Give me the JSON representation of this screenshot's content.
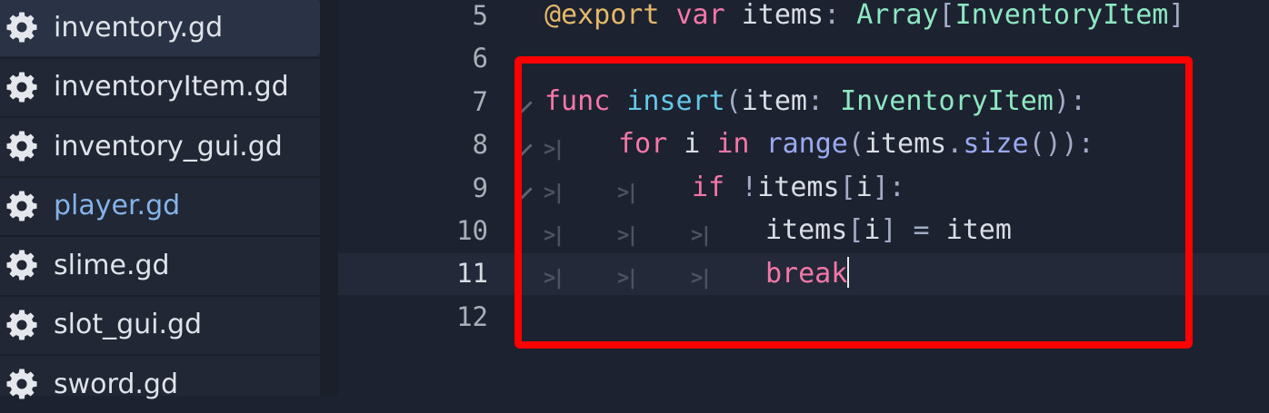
{
  "sidebar": {
    "files": [
      {
        "name": "inventory.gd",
        "selected": true,
        "active": false
      },
      {
        "name": "inventoryItem.gd",
        "selected": false,
        "active": false
      },
      {
        "name": "inventory_gui.gd",
        "selected": false,
        "active": false
      },
      {
        "name": "player.gd",
        "selected": false,
        "active": true
      },
      {
        "name": "slime.gd",
        "selected": false,
        "active": false
      },
      {
        "name": "slot_gui.gd",
        "selected": false,
        "active": false
      },
      {
        "name": "sword.gd",
        "selected": false,
        "active": false
      }
    ]
  },
  "editor": {
    "current_line": 11,
    "lines": [
      {
        "number": "5",
        "indent": 0,
        "tokens": [
          {
            "text": "@export",
            "kind": "annotation"
          },
          {
            "text": " ",
            "kind": "plain"
          },
          {
            "text": "var",
            "kind": "keyword"
          },
          {
            "text": " items",
            "kind": "plain"
          },
          {
            "text": ": ",
            "kind": "punct"
          },
          {
            "text": "Array",
            "kind": "type"
          },
          {
            "text": "[",
            "kind": "punct"
          },
          {
            "text": "InventoryItem",
            "kind": "type"
          },
          {
            "text": "]",
            "kind": "punct"
          }
        ]
      },
      {
        "number": "6",
        "indent": 0,
        "tokens": []
      },
      {
        "number": "7",
        "indent": 0,
        "fold": true,
        "tokens": [
          {
            "text": "func",
            "kind": "keyword"
          },
          {
            "text": " ",
            "kind": "plain"
          },
          {
            "text": "insert",
            "kind": "function"
          },
          {
            "text": "(",
            "kind": "punct"
          },
          {
            "text": "item",
            "kind": "plain"
          },
          {
            "text": ": ",
            "kind": "punct"
          },
          {
            "text": "InventoryItem",
            "kind": "type"
          },
          {
            "text": "):",
            "kind": "punct"
          }
        ]
      },
      {
        "number": "8",
        "indent": 1,
        "fold": true,
        "tokens": [
          {
            "text": "for",
            "kind": "keyword"
          },
          {
            "text": " i ",
            "kind": "plain"
          },
          {
            "text": "in",
            "kind": "keyword"
          },
          {
            "text": " ",
            "kind": "plain"
          },
          {
            "text": "range",
            "kind": "builtin"
          },
          {
            "text": "(",
            "kind": "punct"
          },
          {
            "text": "items",
            "kind": "plain"
          },
          {
            "text": ".",
            "kind": "punct"
          },
          {
            "text": "size",
            "kind": "builtin"
          },
          {
            "text": "()):",
            "kind": "punct"
          }
        ]
      },
      {
        "number": "9",
        "indent": 2,
        "fold": true,
        "tokens": [
          {
            "text": "if",
            "kind": "keyword"
          },
          {
            "text": " ",
            "kind": "plain"
          },
          {
            "text": "!",
            "kind": "punct"
          },
          {
            "text": "items",
            "kind": "plain"
          },
          {
            "text": "[",
            "kind": "punct"
          },
          {
            "text": "i",
            "kind": "plain"
          },
          {
            "text": "]:",
            "kind": "punct"
          }
        ]
      },
      {
        "number": "10",
        "indent": 3,
        "tokens": [
          {
            "text": "items",
            "kind": "plain"
          },
          {
            "text": "[",
            "kind": "punct"
          },
          {
            "text": "i",
            "kind": "plain"
          },
          {
            "text": "]",
            "kind": "punct"
          },
          {
            "text": " = ",
            "kind": "punct"
          },
          {
            "text": "item",
            "kind": "plain"
          }
        ]
      },
      {
        "number": "11",
        "indent": 3,
        "caret": true,
        "tokens": [
          {
            "text": "break",
            "kind": "keyword"
          }
        ]
      },
      {
        "number": "12",
        "indent": 0,
        "tokens": []
      }
    ]
  },
  "colors": {
    "highlight_border": "#ff0000",
    "keyword": "#f477a8",
    "annotation": "#e5b96a",
    "type": "#8de8c2",
    "function": "#64c8e7",
    "builtin": "#9aa9f0"
  },
  "icons": {
    "file": "gear-icon",
    "fold": "fold-arrow-icon",
    "tab": "tab-indicator-icon"
  }
}
